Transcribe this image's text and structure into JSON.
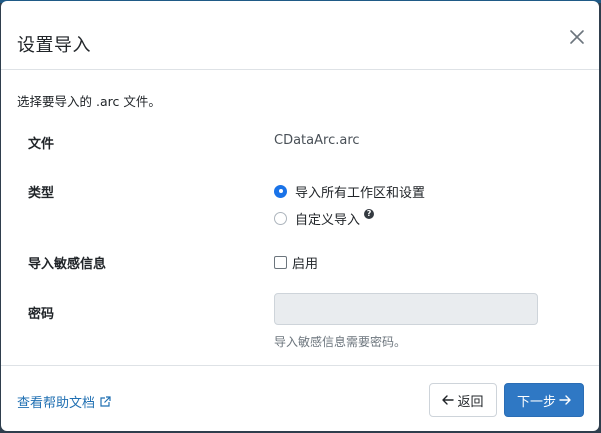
{
  "dialog": {
    "title": "设置导入",
    "intro": "选择要导入的 .arc 文件。"
  },
  "fields": {
    "file_label": "文件",
    "file_value": "CDataArc.arc",
    "type_label": "类型",
    "type_options": [
      {
        "label": "导入所有工作区和设置",
        "selected": true
      },
      {
        "label": "自定义导入",
        "selected": false
      }
    ],
    "sensitive_label": "导入敏感信息",
    "sensitive_checkbox_label": "启用",
    "sensitive_checked": false,
    "password_label": "密码",
    "password_value": "",
    "password_hint": "导入敏感信息需要密码。"
  },
  "footer": {
    "help_link": "查看帮助文档",
    "back_label": "返回",
    "next_label": "下一步"
  },
  "colors": {
    "accent": "#2f78c4",
    "link": "#1f6fb2",
    "radio_checked": "#1a73e8"
  },
  "icons": [
    "close-icon",
    "help-icon",
    "external-link-icon",
    "arrow-left-icon",
    "arrow-right-icon"
  ]
}
